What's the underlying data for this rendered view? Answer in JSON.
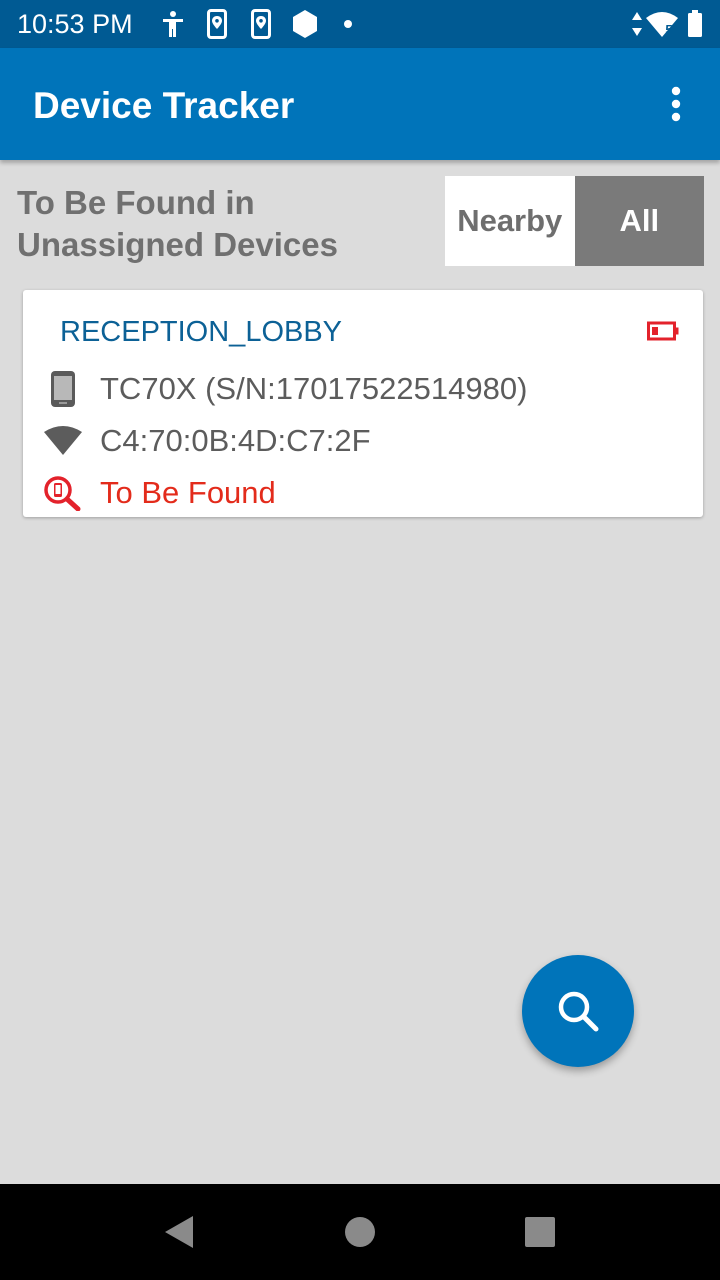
{
  "status_bar": {
    "time": "10:53 PM",
    "icons": [
      "accessibility-icon",
      "device-location-icon",
      "device-location-icon",
      "hexagon-icon",
      "dot-icon",
      "data-arrows-icon",
      "wifi-icon",
      "battery-icon"
    ],
    "wifi_badge": "5"
  },
  "app_bar": {
    "title": "Device Tracker",
    "overflow_icon": "more-vert-icon"
  },
  "header": {
    "heading": "To Be Found in Unassigned Devices",
    "toggle": {
      "nearby_label": "Nearby",
      "all_label": "All",
      "selected": "All"
    }
  },
  "devices": [
    {
      "location": "RECEPTION_LOBBY",
      "battery_status": "low",
      "model": "TC70X (S/N:17017522514980)",
      "mac": "C4:70:0B:4D:C7:2F",
      "status": "To Be Found"
    }
  ],
  "fab": {
    "icon": "search-icon"
  },
  "nav_bar": {
    "icons": [
      "back-icon",
      "home-icon",
      "recents-icon"
    ]
  },
  "colors": {
    "status_bar": "#005a93",
    "app_bar": "#0074ba",
    "background": "#dcdcdc",
    "toggle_selected": "#7a7a7a",
    "card_title": "#0c6196",
    "alert_red": "#e32b1b"
  }
}
